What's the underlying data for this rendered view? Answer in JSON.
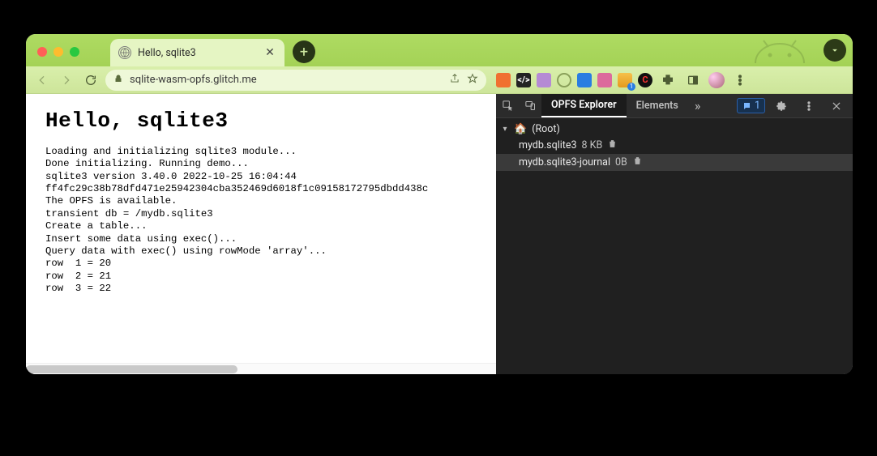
{
  "browser": {
    "tab": {
      "title": "Hello, sqlite3"
    },
    "url": "sqlite-wasm-opfs.glitch.me"
  },
  "page": {
    "heading": "Hello, sqlite3",
    "lines": [
      "Loading and initializing sqlite3 module...",
      "Done initializing. Running demo...",
      "sqlite3 version 3.40.0 2022-10-25 16:04:44",
      "ff4fc29c38b78dfd471e25942304cba352469d6018f1c09158172795dbdd438c",
      "The OPFS is available.",
      "transient db = /mydb.sqlite3",
      "Create a table...",
      "Insert some data using exec()...",
      "Query data with exec() using rowMode 'array'...",
      "row  1 = 20",
      "row  2 = 21",
      "row  3 = 22"
    ]
  },
  "devtools": {
    "tabs": {
      "active": "OPFS Explorer",
      "next": "Elements"
    },
    "messages_badge": "1",
    "root_label": "(Root)",
    "files": [
      {
        "name": "mydb.sqlite3",
        "size": "8 KB"
      },
      {
        "name": "mydb.sqlite3-journal",
        "size": "0B"
      }
    ]
  }
}
